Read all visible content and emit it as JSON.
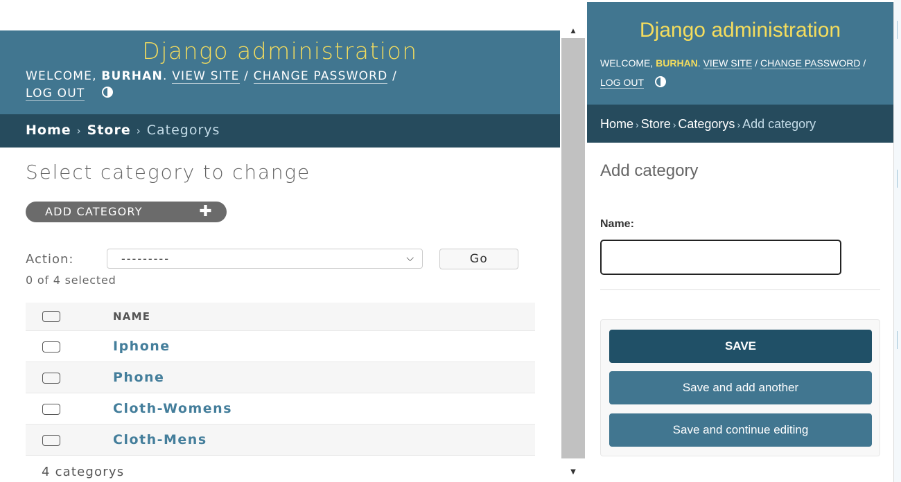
{
  "left": {
    "header": {
      "brand": "Django administration",
      "welcome": "WELCOME,",
      "username": "BURHAN",
      "view_site": "VIEW SITE",
      "change_password": "CHANGE PASSWORD",
      "log_out": "LOG OUT",
      "theme_icon": "theme-toggle-icon"
    },
    "breadcrumbs": [
      "Home",
      "Store",
      "Categorys"
    ],
    "title": "Select category to change",
    "add_button": "ADD CATEGORY",
    "action_label": "Action:",
    "action_value": "---------",
    "go_label": "Go",
    "selected_count": "0 of 4 selected",
    "table": {
      "columns": [
        "NAME"
      ],
      "rows": [
        "Iphone",
        "Phone",
        "Cloth-Womens",
        "Cloth-Mens"
      ]
    },
    "paginator": "4 categorys"
  },
  "right": {
    "header": {
      "brand": "Django administration",
      "welcome": "WELCOME,",
      "username": "BURHAN",
      "view_site": "VIEW SITE",
      "change_password": "CHANGE PASSWORD",
      "log_out": "LOG OUT"
    },
    "breadcrumbs": [
      "Home",
      "Store",
      "Categorys",
      "Add category"
    ],
    "title": "Add category",
    "name_label": "Name:",
    "name_value": "",
    "buttons": {
      "save": "SAVE",
      "save_add": "Save and add another",
      "save_continue": "Save and continue editing"
    }
  },
  "colors": {
    "header_bg": "#417690",
    "breadcrumb_bg": "#264b5d",
    "brand": "#f5dd5d",
    "link": "#447e9b",
    "save_bg": "#205067"
  }
}
